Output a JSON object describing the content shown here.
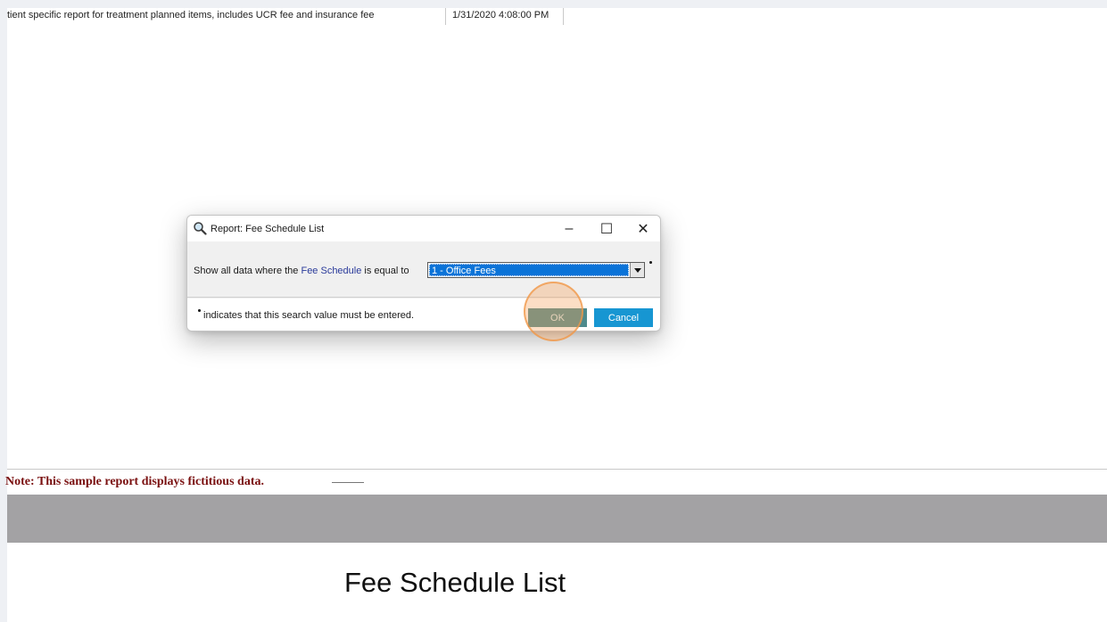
{
  "report_row": {
    "description": "tient specific report for treatment planned items, includes UCR fee and insurance fee",
    "date": "1/31/2020 4:08:00 PM"
  },
  "dialog": {
    "title": "Report: Fee Schedule List",
    "window_controls": {
      "minimize": "–",
      "maximize": "☐",
      "close": "✕"
    },
    "prompt_before": "Show all data where the ",
    "prompt_field": "Fee Schedule",
    "prompt_after": " is equal to",
    "select_value": "1 - Office Fees",
    "footer_note": "indicates that this search value must be entered.",
    "ok_label": "OK",
    "cancel_label": "Cancel"
  },
  "report": {
    "note": "Note:  This sample report displays fictitious data.",
    "title": "Fee Schedule List"
  },
  "colors": {
    "ok_button": "#4e8a8c",
    "cancel_button": "#1796d2",
    "select_highlight": "#0a73d8",
    "note_text": "#7a1010",
    "gray_band": "#a3a2a4"
  },
  "icons": {
    "title_icon": "magnifier-icon"
  }
}
